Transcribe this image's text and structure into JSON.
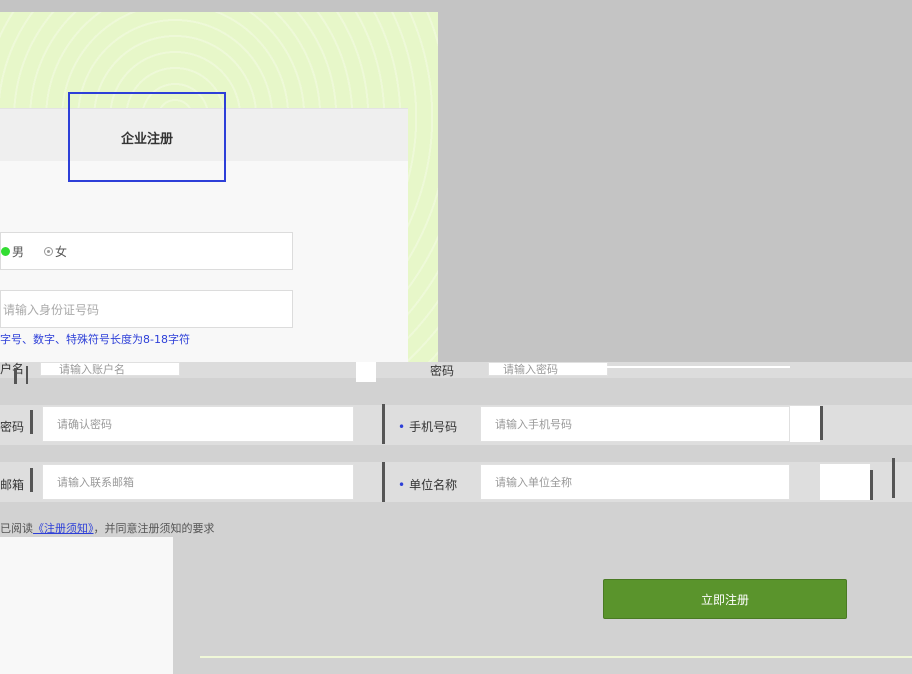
{
  "tab": {
    "label": "企业注册"
  },
  "gender": {
    "male": "男",
    "female": "女",
    "selected": "男"
  },
  "id_field": {
    "placeholder": "请输入身份证号码"
  },
  "password_hint": "字号、数字、特殊符号长度为8-18字符",
  "row_top": {
    "left_label": "户名",
    "left_placeholder": "请输入账户名",
    "right_label": "密码",
    "right_placeholder": "请输入密码"
  },
  "row_confirm": {
    "left_label": "密码",
    "left_placeholder": "请确认密码",
    "right_label": "手机号码",
    "right_placeholder": "请输入手机号码"
  },
  "row_email": {
    "left_label": "邮箱",
    "left_placeholder": "请输入联系邮箱",
    "right_label": "单位名称",
    "right_placeholder": "请输入单位全称"
  },
  "agreement": {
    "prefix": "已阅读",
    "link": "《注册须知》",
    "suffix": "，并同意注册须知的要求"
  },
  "register_button": "立即注册",
  "colors": {
    "accent": "#2d3fd8",
    "brand_green": "#5a942c"
  }
}
